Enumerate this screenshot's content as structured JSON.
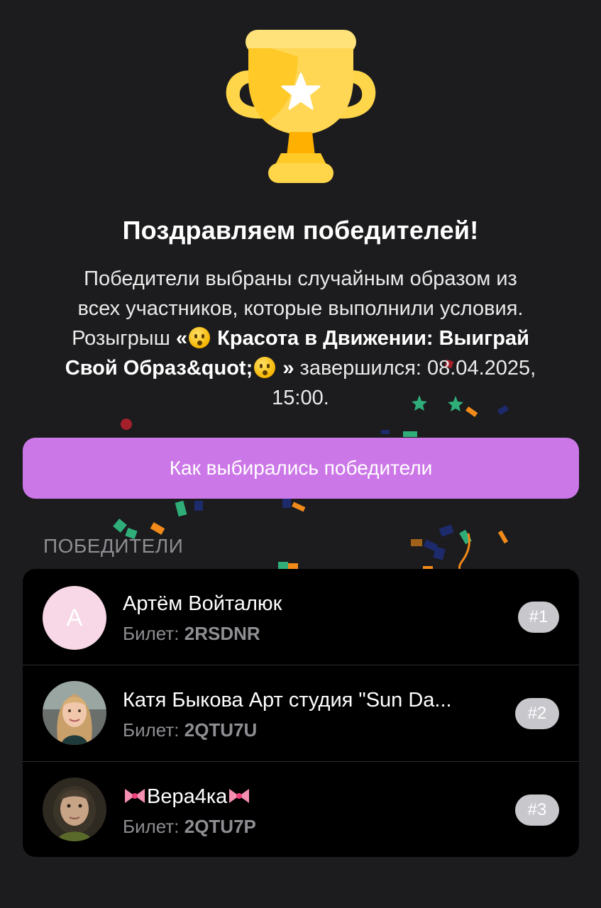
{
  "title": "Поздравляем победителей!",
  "description": {
    "line1": "Победители выбраны случайным образом из",
    "line2": "всех участников, которые выполнили условия.",
    "prefix": "Розыгрыш",
    "quote_open": "«",
    "giveaway_name_part1": "Красота в Движении: Выиграй",
    "giveaway_name_part2": "Свой Образ&quot;",
    "quote_close": "»",
    "ended_label": "завершился: 08.04.2025,",
    "ended_time": "15:00."
  },
  "how_button_label": "Как выбирались победители",
  "winners_section_label": "ПОБЕДИТЕЛИ",
  "ticket_label": "Билет:",
  "winners": [
    {
      "name": "Артём Войталюк",
      "avatar_letter": "А",
      "ticket": "2RSDNR",
      "place": "#1"
    },
    {
      "name": "Катя Быкова Арт студия \"Sun Da...",
      "ticket": "2QTU7U",
      "place": "#2"
    },
    {
      "name": "Вера4ка",
      "ticket": "2QTU7P",
      "place": "#3"
    }
  ],
  "colors": {
    "background": "#1c1c1e",
    "button": "#cc77e8",
    "card": "#000000",
    "badge": "#c7c7cc",
    "avatar_letter_bg": "#f8d7e6"
  },
  "icons": [
    "trophy-icon",
    "star-icon",
    "emoji-hushed-icon",
    "ribbon-bow-icon"
  ]
}
